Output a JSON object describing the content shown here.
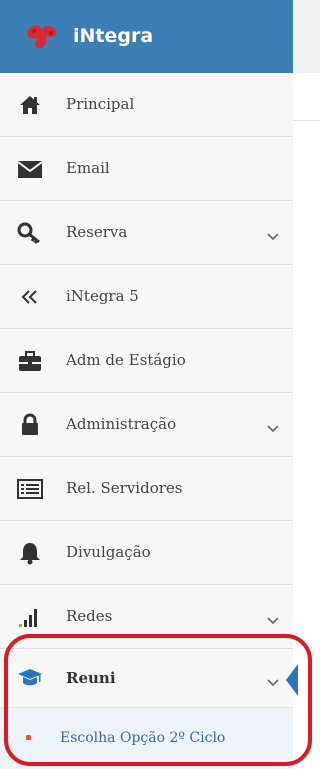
{
  "header": {
    "brand": "iNtegra"
  },
  "menu": [
    {
      "label": "Principal",
      "icon": "home-icon",
      "expandable": false
    },
    {
      "label": "Email",
      "icon": "envelope-icon",
      "expandable": false
    },
    {
      "label": "Reserva",
      "icon": "key-icon",
      "expandable": true
    },
    {
      "label": "iNtegra 5",
      "icon": "double-chevron-left-icon",
      "expandable": false
    },
    {
      "label": "Adm de Estágio",
      "icon": "briefcase-icon",
      "expandable": false
    },
    {
      "label": "Administração",
      "icon": "lock-icon",
      "expandable": true
    },
    {
      "label": "Rel. Servidores",
      "icon": "list-icon",
      "expandable": false
    },
    {
      "label": "Divulgação",
      "icon": "bell-icon",
      "expandable": false
    },
    {
      "label": "Redes",
      "icon": "signal-icon",
      "expandable": true
    },
    {
      "label": "Reuni",
      "icon": "graduation-cap-icon",
      "expandable": true
    }
  ],
  "submenu": {
    "label": "Escolha Opção 2º Ciclo"
  },
  "colors": {
    "header": "#3c7fb5",
    "accent": "#2b74c0",
    "highlight": "#d81c25"
  }
}
